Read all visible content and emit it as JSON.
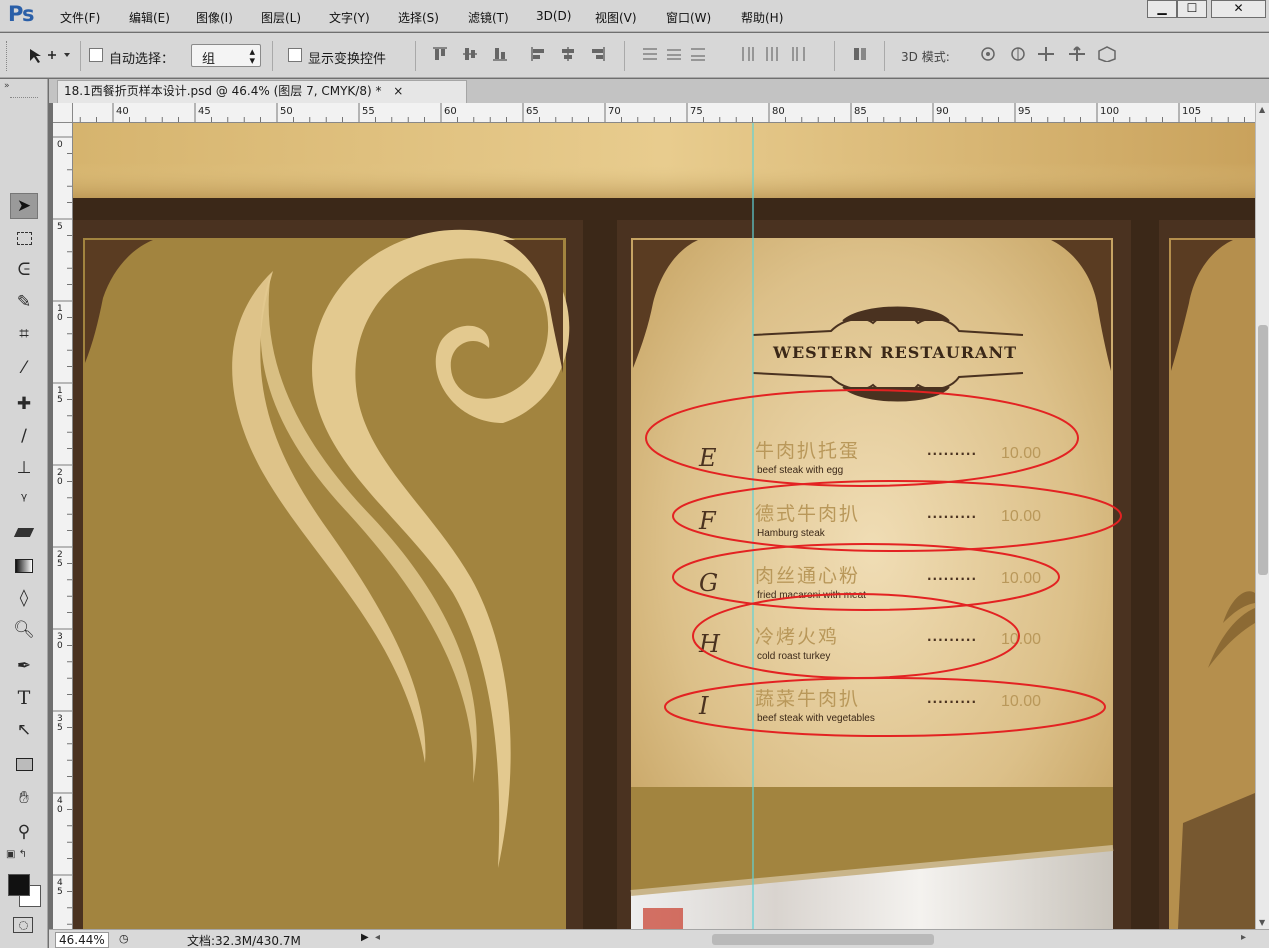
{
  "app": {
    "logo": "Ps",
    "menu": [
      "文件(F)",
      "编辑(E)",
      "图像(I)",
      "图层(L)",
      "文字(Y)",
      "选择(S)",
      "滤镜(T)",
      "3D(D)",
      "视图(V)",
      "窗口(W)",
      "帮助(H)"
    ],
    "window_controls": {
      "minimize": "▁",
      "maximize": "☐",
      "close": "✕"
    }
  },
  "options_bar": {
    "auto_select_label": "自动选择：",
    "auto_select_value": "组",
    "show_transform_label": "显示变换控件",
    "mode_3d_label": "3D 模式:"
  },
  "document": {
    "tab_title": "18.1西餐折页样本设计.psd @ 46.4% (图层 7, CMYK/8) *",
    "tab_close": "×",
    "zoom": "46.44%",
    "doc_size": "文档:32.3M/430.7M"
  },
  "rulers": {
    "horizontal_ticks": [
      "40",
      "45",
      "50",
      "55",
      "60",
      "65",
      "70",
      "75",
      "80",
      "85",
      "90",
      "95",
      "100",
      "105"
    ],
    "vertical_ticks": [
      "0",
      "5",
      "10",
      "15",
      "20",
      "25",
      "30",
      "35",
      "40",
      "45"
    ]
  },
  "menu_design": {
    "title": "WESTERN RESTAURANT",
    "items": [
      {
        "letter": "E",
        "cn": "牛肉扒托蛋",
        "en": "beef steak with egg",
        "dots": ".........",
        "price": "10.00"
      },
      {
        "letter": "F",
        "cn": "德式牛肉扒",
        "en": "Hamburg steak",
        "dots": ".........",
        "price": "10.00"
      },
      {
        "letter": "G",
        "cn": "肉丝通心粉",
        "en": "fried macaroni with meat",
        "dots": ".........",
        "price": "10.00"
      },
      {
        "letter": "H",
        "cn": "冷烤火鸡",
        "en": "cold roast turkey",
        "dots": ".........",
        "price": "10.00"
      },
      {
        "letter": "I",
        "cn": "蔬菜牛肉扒",
        "en": "beef steak with vegetables",
        "dots": ".........",
        "price": "10.00"
      }
    ]
  },
  "colors": {
    "frame_dark": "#4a3220",
    "panel_brown": "#a2843f",
    "swirl_cream": "#e3c98f",
    "menu_text_gold": "#b9985a",
    "annotation_red": "#e32222",
    "guide_cyan": "#5fd3d8"
  },
  "tools": [
    "move-icon",
    "marquee-icon",
    "lasso-icon",
    "quick-select-icon",
    "crop-icon",
    "eyedropper-icon",
    "healing-brush-icon",
    "brush-icon",
    "stamp-icon",
    "history-brush-icon",
    "eraser-icon",
    "gradient-icon",
    "blur-icon",
    "dodge-icon",
    "pen-icon",
    "type-icon",
    "path-select-icon",
    "rectangle-icon",
    "hand-icon",
    "zoom-icon"
  ]
}
